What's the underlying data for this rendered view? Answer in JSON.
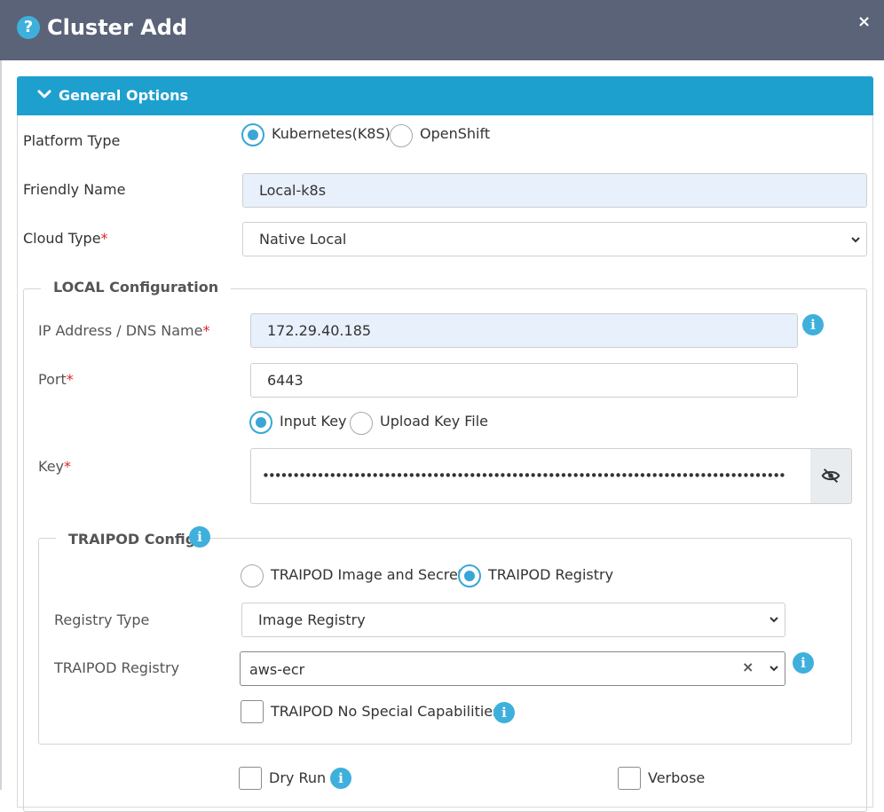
{
  "dialog": {
    "title": "Cluster Add",
    "close_glyph": "×",
    "help_glyph": "?"
  },
  "accordion": {
    "title": "General Options"
  },
  "platform": {
    "label": "Platform Type",
    "options": [
      {
        "label": "Kubernetes(K8S)",
        "selected": true
      },
      {
        "label": "OpenShift",
        "selected": false
      }
    ]
  },
  "friendly_name": {
    "label": "Friendly Name",
    "value": "Local-k8s"
  },
  "cloud_type": {
    "label": "Cloud Type",
    "required_mark": "*",
    "value": "Native Local"
  },
  "local_config": {
    "legend": "LOCAL Configuration",
    "ip": {
      "label": "IP Address / DNS Name",
      "required_mark": "*",
      "value": "172.29.40.185"
    },
    "port": {
      "label": "Port",
      "required_mark": "*",
      "value": "6443"
    },
    "key_mode": {
      "options": [
        {
          "label": "Input Key",
          "selected": true
        },
        {
          "label": "Upload Key File",
          "selected": false
        }
      ]
    },
    "key": {
      "label": "Key",
      "required_mark": "*",
      "masked_value": "••••••••••••••••••••••••••••••••••••••••••••••••••••••••••••••••••••••••••••••••••••••"
    }
  },
  "traipod": {
    "legend": "TRAIPOD Config",
    "mode": {
      "options": [
        {
          "label": "TRAIPOD Image and Secret",
          "selected": false
        },
        {
          "label": "TRAIPOD Registry",
          "selected": true
        }
      ]
    },
    "registry_type": {
      "label": "Registry Type",
      "value": "Image Registry"
    },
    "registry": {
      "label": "TRAIPOD Registry",
      "value": "aws-ecr",
      "clear_glyph": "×"
    },
    "no_special": {
      "label": "TRAIPOD No Special Capabilities",
      "checked": false
    }
  },
  "options": {
    "dry_run": {
      "label": "Dry Run",
      "checked": false
    },
    "verbose": {
      "label": "Verbose",
      "checked": false
    }
  },
  "icons": {
    "info": "info-icon",
    "help": "question-circle-icon",
    "close": "close-icon",
    "chevron": "chevron-down-icon",
    "eye": "eye-slash-icon"
  },
  "colors": {
    "header_bg": "#5a6378",
    "accent": "#1ea0cf",
    "info": "#3fb0dc",
    "required": "#e0262a",
    "filled_input": "#e8f0fc"
  }
}
